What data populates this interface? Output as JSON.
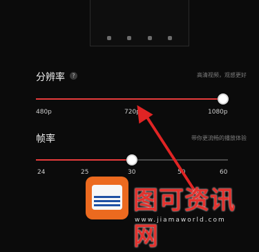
{
  "resolution": {
    "title": "分辨率",
    "help": "?",
    "hint": "高清视频，观感更好",
    "ticks": [
      "480p",
      "720p",
      "1080p"
    ],
    "selected_fraction": 1.0
  },
  "framerate": {
    "title": "帧率",
    "hint": "带你更流畅的播放体验",
    "ticks": [
      "24",
      "25",
      "30",
      "50",
      "60"
    ],
    "selected_value": "30"
  },
  "watermark": {
    "title": "图可资讯网",
    "url": "www.jiamaworld.com"
  },
  "colors": {
    "accent": "#e83c3c",
    "arrow": "#e02424",
    "logo": "#ec6a1f"
  }
}
